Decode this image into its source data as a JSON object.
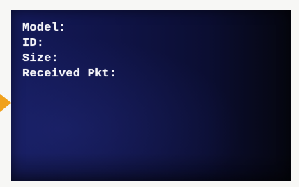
{
  "display": {
    "fields": [
      {
        "label": "Model:"
      },
      {
        "label": "ID:"
      },
      {
        "label": "Size:"
      },
      {
        "label": "Received Pkt:"
      }
    ]
  },
  "colors": {
    "screen_background": "#101448",
    "text": "#f4f4f8",
    "pointer": "#f0a11c"
  },
  "icons": {
    "pointer": "orange-pointer-arrow-icon"
  }
}
